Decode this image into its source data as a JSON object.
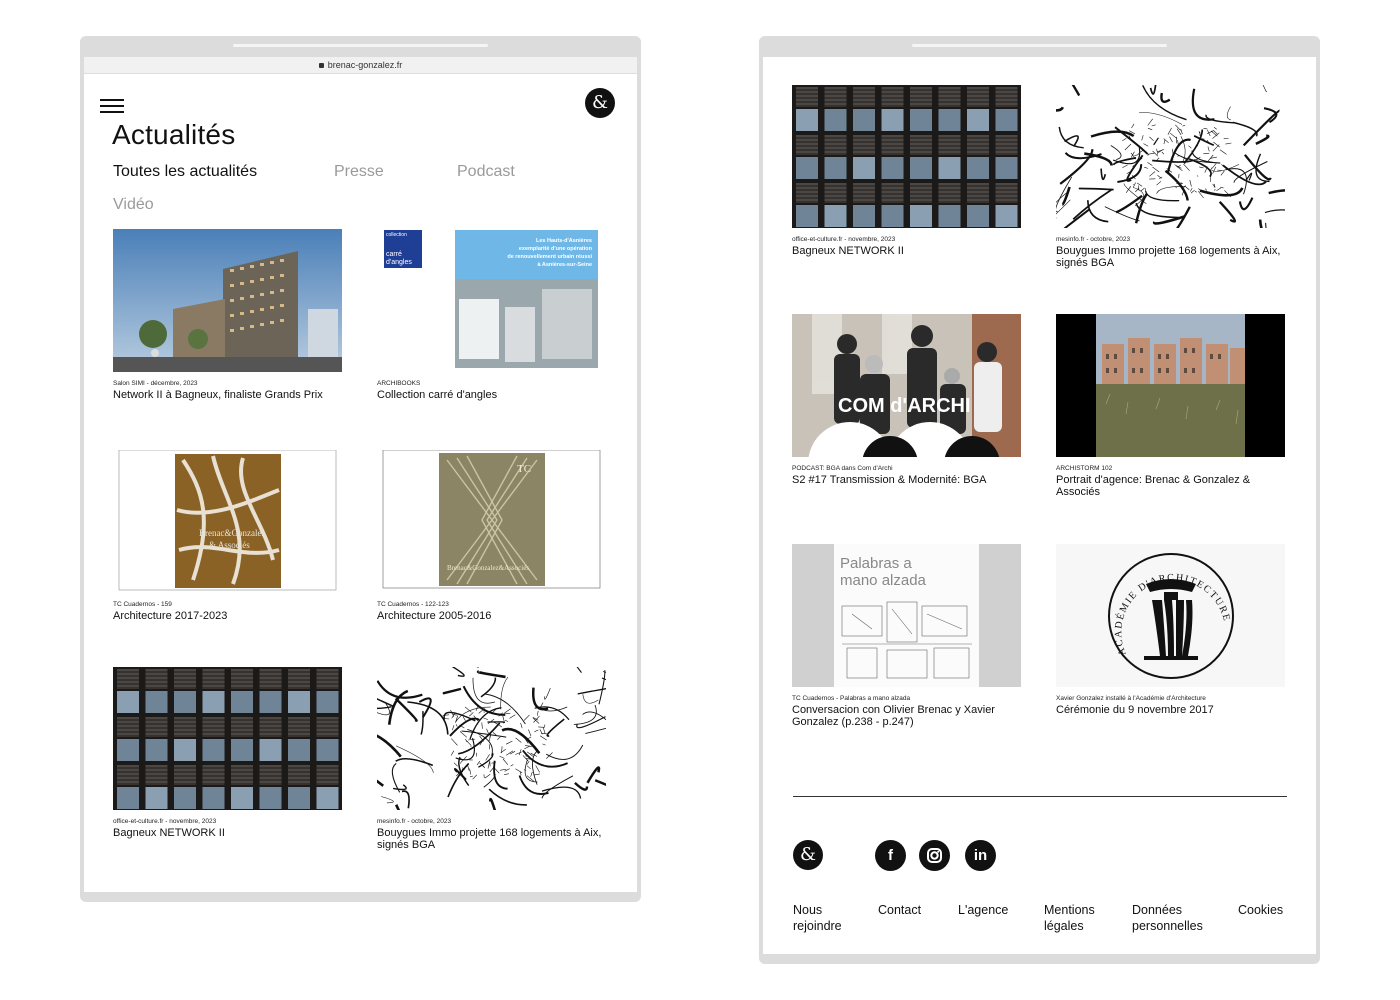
{
  "left": {
    "url": "brenac-gonzalez.fr",
    "title": "Actualités",
    "filters": [
      "Toutes les actualités",
      "Presse",
      "Podcast",
      "Vidéo"
    ],
    "cards": [
      {
        "meta": "Salon SIMI - décembre, 2023",
        "title": "Network II à Bagneux, finaliste Grands Prix"
      },
      {
        "meta": "ARCHIBOOKS",
        "title": "Collection carré d'angles",
        "cover_brand": "collection carré d'angles",
        "cover_text": "Les Hauts-d'Asnières exemplarité d'une opération de renouvellement urbain réussi à Asnières-sur-Seine"
      },
      {
        "meta": "TC Cuadernos - 159",
        "title": "Architecture 2017-2023",
        "cover_text": "Brenac&Gonzalez & Associés"
      },
      {
        "meta": "TC Cuadernos - 122-123",
        "title": "Architecture 2005-2016",
        "cover_mark": "TC",
        "cover_text": "Brenac&Gonzalez&Associés"
      },
      {
        "meta": "office-et-culture.fr - novembre, 2023",
        "title": "Bagneux NETWORK II"
      },
      {
        "meta": "mesinfo.fr - octobre, 2023",
        "title": "Bouygues Immo projette 168 logements à Aix, signés BGA"
      }
    ]
  },
  "right": {
    "cards": [
      {
        "meta": "office-et-culture.fr - novembre, 2023",
        "title": "Bagneux NETWORK II"
      },
      {
        "meta": "mesinfo.fr - octobre, 2023",
        "title": "Bouygues Immo projette 168 logements à Aix, signés BGA"
      },
      {
        "meta": "PODCAST: BGA dans Com d'Archi",
        "title": "S2 #17 Transmission & Modernité: BGA",
        "overlay": "COM d'ARCHI"
      },
      {
        "meta": "ARCHISTORM 102",
        "title": "Portrait d'agence: Brenac & Gonzalez & Associés"
      },
      {
        "meta": "TC Cuadernos - Palabras a mano alzada",
        "title": "Conversacion con Olivier Brenac y Xavier Gonzalez (p.238 - p.247)",
        "overlay": "Palabras a mano alzada"
      },
      {
        "meta": "Xavier Gonzalez installé à l'Académie d'Architecture",
        "title": "Cérémonie du 9 novembre 2017",
        "overlay": "ACADÉMIE D'ARCHITECTURE"
      }
    ],
    "footer_links": [
      {
        "line1": "Nous",
        "line2": "rejoindre"
      },
      {
        "line1": "Contact",
        "line2": ""
      },
      {
        "line1": "L'agence",
        "line2": ""
      },
      {
        "line1": "Mentions",
        "line2": "légales"
      },
      {
        "line1": "Données",
        "line2": "personnelles"
      },
      {
        "line1": "Cookies",
        "line2": ""
      }
    ],
    "social": [
      "f",
      "in"
    ]
  },
  "icons": {
    "logo": "ampersand-logo-icon",
    "menu": "hamburger-menu-icon",
    "facebook": "facebook-icon",
    "instagram": "instagram-icon",
    "linkedin": "linkedin-icon"
  }
}
